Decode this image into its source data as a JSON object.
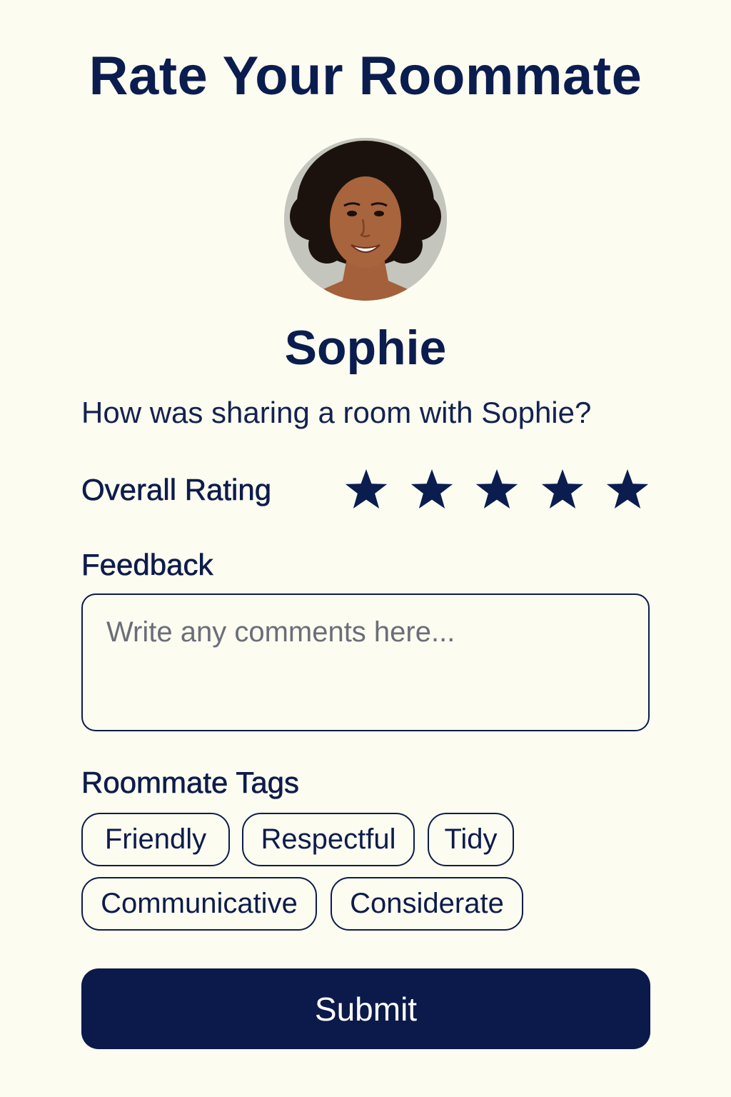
{
  "page": {
    "title": "Rate Your Roommate"
  },
  "roommate": {
    "name": "Sophie",
    "avatar_icon": "person-photo"
  },
  "question": "How was sharing a room with Sophie?",
  "rating": {
    "label": "Overall Rating",
    "value": 5,
    "max": 5,
    "star_color": "#0b1d4f"
  },
  "feedback": {
    "label": "Feedback",
    "placeholder": "Write any comments here...",
    "value": ""
  },
  "tags": {
    "label": "Roommate Tags",
    "items": [
      {
        "label": "Friendly"
      },
      {
        "label": "Respectful"
      },
      {
        "label": "Tidy"
      },
      {
        "label": "Communicative"
      },
      {
        "label": "Considerate"
      }
    ]
  },
  "submit": {
    "label": "Submit"
  },
  "colors": {
    "background": "#fcfcf1",
    "primary": "#0b1a4a"
  }
}
